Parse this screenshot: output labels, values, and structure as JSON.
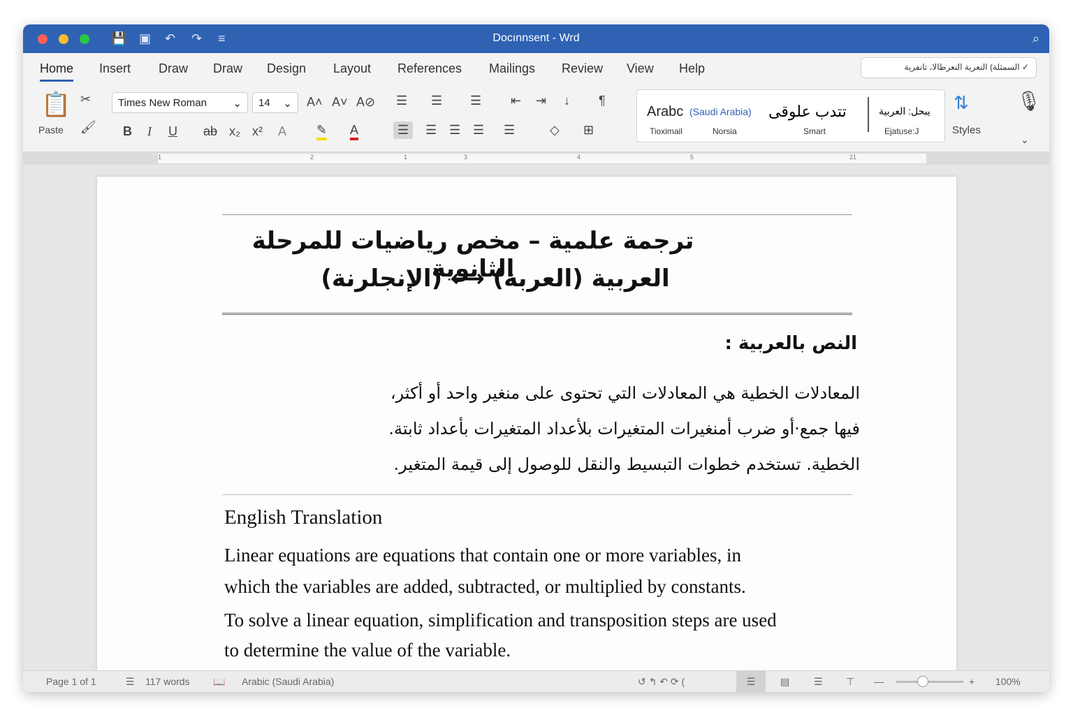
{
  "window": {
    "title": "Docınnsent - Wrd"
  },
  "tabs": [
    "Home",
    "Insert",
    "Draw",
    "Draw",
    "Design",
    "Layout",
    "References",
    "Mailings",
    "Review",
    "View",
    "Help"
  ],
  "share_label": "السمثلة) النعرية النعرطالا، تانفرية",
  "ribbon": {
    "paste": "Paste",
    "font": "Times New Roman",
    "size": "14",
    "styles_label": "Styles",
    "gallery": {
      "sample1": "Arabc",
      "sample1_note": "(Saudi Arabia)",
      "sample2": "تتدب علوقى",
      "sample3": "يبحل: العربية",
      "names": [
        "Tioximail",
        "Norsia",
        "Smart",
        "Ejatuse:J"
      ]
    }
  },
  "ruler": [
    "1",
    "2",
    "1",
    "3",
    "4",
    "5",
    "21"
  ],
  "document": {
    "title_line1": "ترجمة علمية – مخص رياضيات للمرحلة الثانوية",
    "title_line2": "العربية (العربة) ⟷ (الإنجلرنة)",
    "arabic_heading": "النص بالعربية :",
    "arabic_lines": [
      "المعادلات الخطية هي المعادلات التي تحتوى على منغير واحد أو أكثر،",
      "فيها جمع·أو ضرب أمنغيرات المتغيرات بلأعداد المتغيرات بأعداد ثابتة.",
      "الخطية. تستخدم خطوات التبسيط والنقل للوصول إلى قيمة المتغير."
    ],
    "english_heading": "English Translation",
    "english_lines": [
      "Linear equations are equations that contain one or more variables, in",
      "which the variables are added, subtracted, or multiplied by constants.",
      "To solve a linear equation, simplification and transposition steps are used",
      "to determine the value of the variable."
    ]
  },
  "status": {
    "page": "Page 1 of 1",
    "words": "117 words",
    "language": "Arabic (Saudi Arabia)",
    "zoom": "100%",
    "zoom_value": 100
  }
}
